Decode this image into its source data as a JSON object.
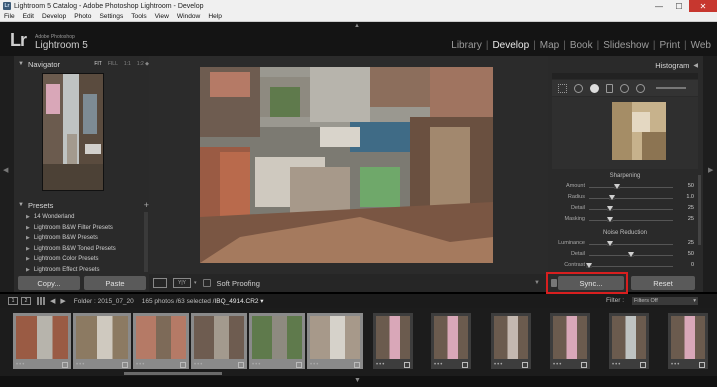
{
  "window": {
    "title": "Lightroom 5 Catalog - Adobe Photoshop Lightroom - Develop",
    "app_icon": "Lr",
    "minimize": "—",
    "maximize": "☐",
    "close": "✕"
  },
  "menu": [
    "File",
    "Edit",
    "Develop",
    "Photo",
    "Settings",
    "Tools",
    "View",
    "Window",
    "Help"
  ],
  "identity": {
    "logo": "Lr",
    "brand_small": "Adobe Photoshop",
    "brand_name": "Lightroom 5"
  },
  "modules": [
    "Library",
    "Develop",
    "Map",
    "Book",
    "Slideshow",
    "Print",
    "Web"
  ],
  "active_module": "Develop",
  "navigator": {
    "title": "Navigator",
    "zoom_options": [
      "FIT",
      "FILL",
      "1:1",
      "1:2 ◆"
    ]
  },
  "presets": {
    "title": "Presets",
    "add": "+",
    "items": [
      "14 Wonderland",
      "Lightroom B&W Filter Presets",
      "Lightroom B&W Presets",
      "Lightroom B&W Toned Presets",
      "Lightroom Color Presets",
      "Lightroom Effect Presets"
    ]
  },
  "left_buttons": {
    "copy": "Copy...",
    "paste": "Paste"
  },
  "toolbar": {
    "yy_label": "Y|Y",
    "soft_proofing": "Soft Proofing"
  },
  "histogram": {
    "title": "Histogram"
  },
  "sharpening": {
    "title": "Sharpening",
    "sliders": [
      {
        "label": "Amount",
        "value": "50",
        "pos": 0.33
      },
      {
        "label": "Radius",
        "value": "1.0",
        "pos": 0.27
      },
      {
        "label": "Detail",
        "value": "25",
        "pos": 0.25
      },
      {
        "label": "Masking",
        "value": "25",
        "pos": 0.25
      }
    ]
  },
  "noise_reduction": {
    "title": "Noise Reduction",
    "sliders": [
      {
        "label": "Luminance",
        "value": "25",
        "pos": 0.25
      },
      {
        "label": "Detail",
        "value": "50",
        "pos": 0.5
      },
      {
        "label": "Contrast",
        "value": "0",
        "pos": 0.0
      }
    ]
  },
  "right_buttons": {
    "sync": "Sync...",
    "reset": "Reset"
  },
  "filmstrip": {
    "num_primary": "1",
    "num_secondary": "2",
    "folder": "Folder : 2015_07_20",
    "count": "165 photos /63 selected /",
    "filename": "IBQ_4914.CR2 ▾",
    "filter_label": "Filter :",
    "filter_value": "Filters Off",
    "thumb_dots": "•••"
  },
  "colors": {
    "accent_red": "#d81f1f",
    "panel": "#2a2a2a",
    "background": "#2b2b2b"
  }
}
